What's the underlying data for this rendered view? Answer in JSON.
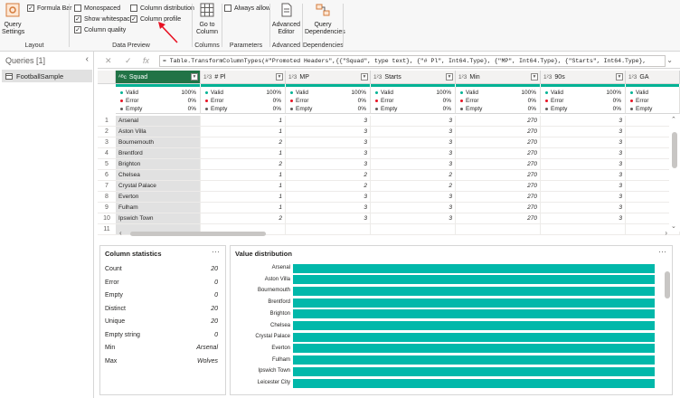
{
  "ribbon": {
    "query_settings_label": "Query Settings",
    "layout_group_label": "Layout",
    "data_preview_group_label": "Data Preview",
    "columns_group_label": "Columns",
    "parameters_group_label": "Parameters",
    "advanced_group_label": "Advanced",
    "dependencies_group_label": "Dependencies",
    "formula_bar": {
      "label": "Formula Bar",
      "checked": true
    },
    "monospaced": {
      "label": "Monospaced",
      "checked": false
    },
    "show_whitespace": {
      "label": "Show whitespace",
      "checked": true
    },
    "column_quality": {
      "label": "Column quality",
      "checked": true
    },
    "column_distribution": {
      "label": "Column distribution",
      "checked": false
    },
    "column_profile": {
      "label": "Column profile",
      "checked": true
    },
    "go_to_column_label": "Go to Column",
    "always_allow": {
      "label": "Always allow",
      "checked": false
    },
    "advanced_editor_label": "Advanced Editor",
    "query_dependencies_label": "Query Dependencies"
  },
  "queries": {
    "header": "Queries [1]",
    "items": [
      "FootballSample"
    ]
  },
  "formula_bar": {
    "fx": "fx",
    "text": "= Table.TransformColumnTypes(#\"Promoted Headers\",{{\"Squad\", type text}, {\"# Pl\", Int64.Type}, {\"MP\", Int64.Type}, {\"Starts\", Int64.Type},"
  },
  "grid": {
    "columns": [
      {
        "name": "Squad",
        "type": "ABC"
      },
      {
        "name": "# Pl",
        "type": "123"
      },
      {
        "name": "MP",
        "type": "123"
      },
      {
        "name": "Starts",
        "type": "123"
      },
      {
        "name": "Min",
        "type": "123"
      },
      {
        "name": "90s",
        "type": "123"
      },
      {
        "name": "GA",
        "type": "123"
      }
    ],
    "quality": [
      {
        "valid": "100%",
        "error": "0%",
        "empty": "0%"
      },
      {
        "valid": "100%",
        "error": "0%",
        "empty": "0%"
      },
      {
        "valid": "100%",
        "error": "0%",
        "empty": "0%"
      },
      {
        "valid": "100%",
        "error": "0%",
        "empty": "0%"
      },
      {
        "valid": "100%",
        "error": "0%",
        "empty": "0%"
      },
      {
        "valid": "100%",
        "error": "0%",
        "empty": "0%"
      },
      {
        "valid": "",
        "error": "",
        "empty": ""
      }
    ],
    "quality_labels": {
      "valid": "Valid",
      "error": "Error",
      "empty": "Empty"
    },
    "rows": [
      [
        "Arsenal",
        "1",
        "3",
        "3",
        "270",
        "3"
      ],
      [
        "Aston Villa",
        "1",
        "3",
        "3",
        "270",
        "3"
      ],
      [
        "Bournemouth",
        "2",
        "3",
        "3",
        "270",
        "3"
      ],
      [
        "Brentford",
        "1",
        "3",
        "3",
        "270",
        "3"
      ],
      [
        "Brighton",
        "2",
        "3",
        "3",
        "270",
        "3"
      ],
      [
        "Chelsea",
        "1",
        "2",
        "2",
        "270",
        "3"
      ],
      [
        "Crystal Palace",
        "1",
        "2",
        "2",
        "270",
        "3"
      ],
      [
        "Everton",
        "1",
        "3",
        "3",
        "270",
        "3"
      ],
      [
        "Fulham",
        "1",
        "3",
        "3",
        "270",
        "3"
      ],
      [
        "Ipswich Town",
        "2",
        "3",
        "3",
        "270",
        "3"
      ],
      [
        "",
        "",
        "",
        "",
        "",
        ""
      ]
    ]
  },
  "column_statistics": {
    "title": "Column statistics",
    "rows": [
      {
        "label": "Count",
        "value": "20"
      },
      {
        "label": "Error",
        "value": "0"
      },
      {
        "label": "Empty",
        "value": "0"
      },
      {
        "label": "Distinct",
        "value": "20"
      },
      {
        "label": "Unique",
        "value": "20"
      },
      {
        "label": "Empty string",
        "value": "0"
      },
      {
        "label": "Min",
        "value": "Arsenal"
      },
      {
        "label": "Max",
        "value": "Wolves"
      }
    ]
  },
  "value_distribution": {
    "title": "Value distribution",
    "labels": [
      "Arsenal",
      "Aston Villa",
      "Bournemouth",
      "Brentford",
      "Brighton",
      "Chelsea",
      "Crystal Palace",
      "Everton",
      "Fulham",
      "Ipswich Town",
      "Leicester City"
    ],
    "bar_fraction": 1.0
  },
  "colors": {
    "accent": "#217346",
    "quality": "#00b294",
    "distribution": "#01b8aa",
    "annotation": "#e81123"
  }
}
